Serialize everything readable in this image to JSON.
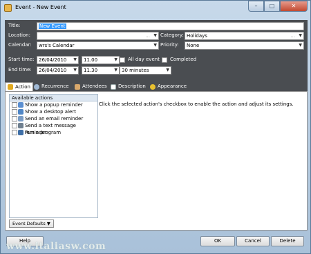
{
  "window": {
    "title": "Event - New Event"
  },
  "form": {
    "title_label": "Title:",
    "title_value": "New Event",
    "location_label": "Location:",
    "location_value": "",
    "location_ellipsis": "...",
    "category_label": "Category:",
    "category_value": "Holidays",
    "calendar_label": "Calendar:",
    "calendar_value": "wrs's Calendar",
    "priority_label": "Priority:",
    "priority_value": "None",
    "start_label": "Start time:",
    "start_date": "26/04/2010",
    "start_time": "11.00",
    "allday_label": "All day event",
    "completed_label": "Completed",
    "end_label": "End time:",
    "end_date": "26/04/2010",
    "end_time": "11.30",
    "duration": "30 minutes"
  },
  "tabs": [
    {
      "label": "Action",
      "active": true
    },
    {
      "label": "Recurrence"
    },
    {
      "label": "Attendees"
    },
    {
      "label": "Description"
    },
    {
      "label": "Appearance"
    }
  ],
  "actions": {
    "header": "Available actions",
    "items": [
      {
        "label": "Show a popup reminder",
        "icon": "popup-icon",
        "color": "#5b8fd1"
      },
      {
        "label": "Show a desktop alert",
        "icon": "alert-icon",
        "color": "#4f86c6"
      },
      {
        "label": "Send an email reminder",
        "icon": "email-icon",
        "color": "#7a9cc5"
      },
      {
        "label": "Send a text message reminder",
        "icon": "phone-icon",
        "color": "#6f7f8f"
      },
      {
        "label": "Run a program",
        "icon": "program-icon",
        "color": "#3f6fa7"
      }
    ],
    "hint": "Click the selected action's checkbox to enable the action and adjust its settings.",
    "event_defaults": "Event Defaults"
  },
  "buttons": {
    "help": "Help",
    "ok": "OK",
    "cancel": "Cancel",
    "delete": "Delete"
  },
  "watermark": "www.italiasw.com"
}
